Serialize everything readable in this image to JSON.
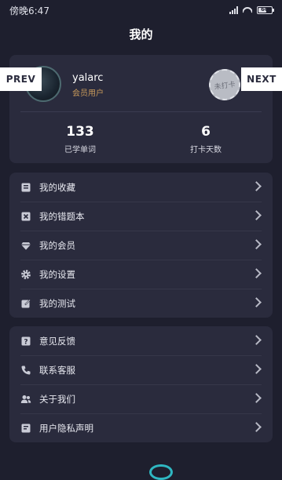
{
  "status": {
    "time": "傍晚6:47",
    "battery": "60",
    "battery_level": 0.6
  },
  "header": {
    "title": "我的"
  },
  "profile": {
    "username": "yalarc",
    "member_label": "会员用户",
    "stamp_text": "未打卡",
    "stats": [
      {
        "value": "133",
        "label": "已学单词"
      },
      {
        "value": "6",
        "label": "打卡天数"
      }
    ]
  },
  "nav": {
    "prev": "PREV",
    "next": "NEXT"
  },
  "menu_group_1": [
    {
      "label": "我的收藏",
      "icon": "bookmark-icon"
    },
    {
      "label": "我的错题本",
      "icon": "wrong-book-icon"
    },
    {
      "label": "我的会员",
      "icon": "diamond-icon"
    },
    {
      "label": "我的设置",
      "icon": "gear-icon"
    },
    {
      "label": "我的测试",
      "icon": "edit-icon"
    }
  ],
  "menu_group_2": [
    {
      "label": "意见反馈",
      "icon": "feedback-icon"
    },
    {
      "label": "联系客服",
      "icon": "phone-icon"
    },
    {
      "label": "关于我们",
      "icon": "users-icon"
    },
    {
      "label": "用户隐私声明",
      "icon": "privacy-icon"
    }
  ],
  "colors": {
    "background": "#1e1f2e",
    "card": "#2a2b3d",
    "member": "#c89a5b"
  }
}
